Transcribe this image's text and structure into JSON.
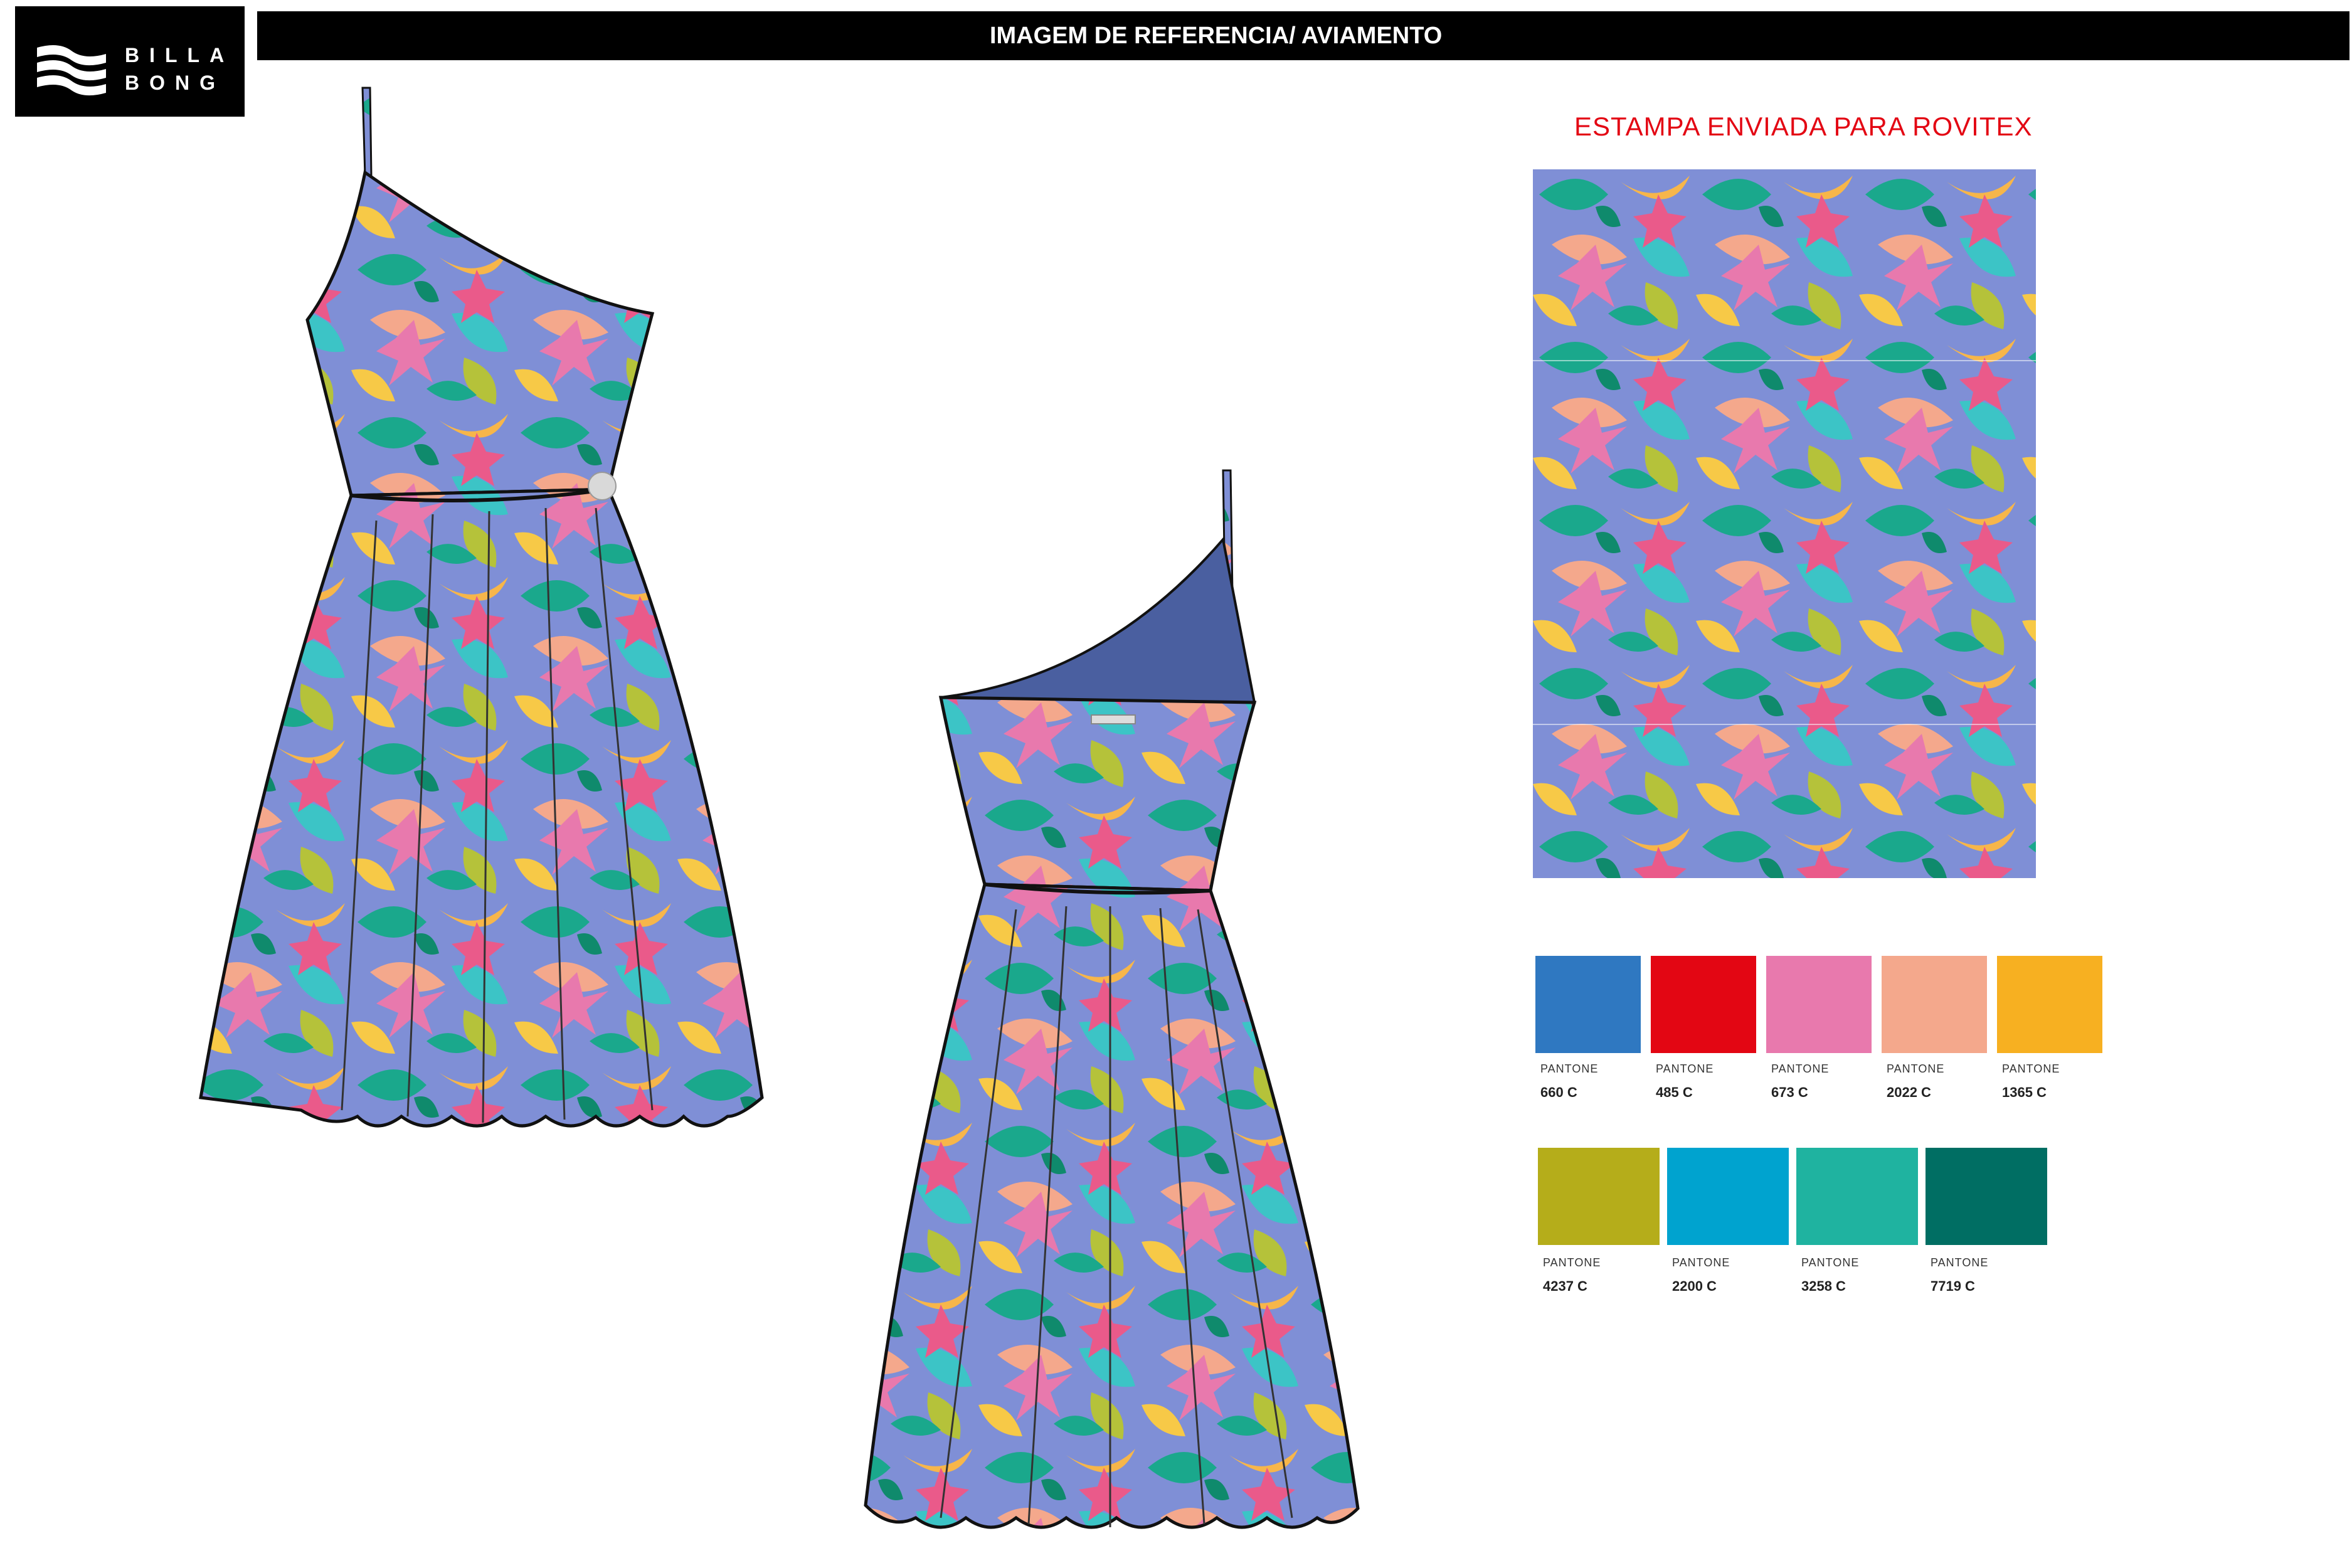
{
  "logo": {
    "line1": "BILLA",
    "line2": "BONG"
  },
  "header": {
    "title": "IMAGEM DE REFERENCIA/ AVIAMENTO"
  },
  "print": {
    "title": "ESTAMPA ENVIADA PARA ROVITEX"
  },
  "palette": {
    "row1": [
      {
        "brand": "PANTONE",
        "code": "660 C",
        "color": "#2f78c1"
      },
      {
        "brand": "PANTONE",
        "code": "485 C",
        "color": "#e30613"
      },
      {
        "brand": "PANTONE",
        "code": "673 C",
        "color": "#e879ad"
      },
      {
        "brand": "PANTONE",
        "code": "2022 C",
        "color": "#f4a88c"
      },
      {
        "brand": "PANTONE",
        "code": "1365 C",
        "color": "#f7b021"
      }
    ],
    "row2": [
      {
        "brand": "PANTONE",
        "code": "4237 C",
        "color": "#b5ad1a"
      },
      {
        "brand": "PANTONE",
        "code": "2200 C",
        "color": "#00a3cf"
      },
      {
        "brand": "PANTONE",
        "code": "3258 C",
        "color": "#1fb3a0"
      },
      {
        "brand": "PANTONE",
        "code": "7719 C",
        "color": "#006e63"
      }
    ]
  }
}
